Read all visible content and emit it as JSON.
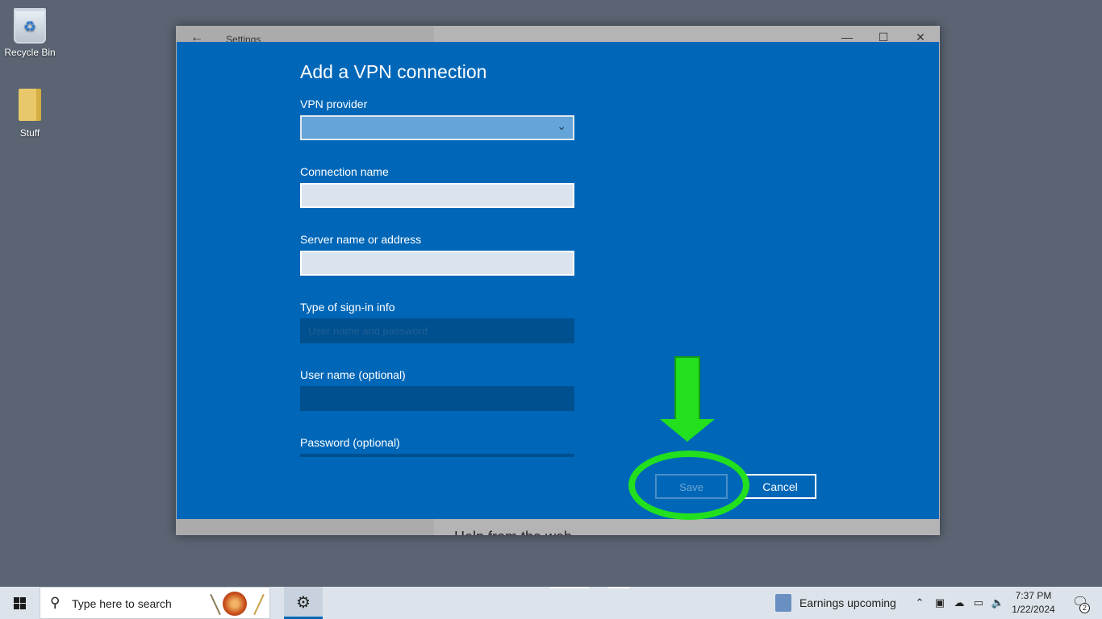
{
  "desktop": {
    "icons": [
      {
        "label": "Recycle Bin",
        "icon": "recycle-bin-icon"
      },
      {
        "label": "Stuff",
        "icon": "folder-icon"
      }
    ]
  },
  "settings_window": {
    "title": "Settings",
    "footer_text": "Help from the web",
    "controls": {
      "back": "←",
      "minimize": "—",
      "maximize": "☐",
      "close": "✕"
    }
  },
  "dialog": {
    "title": "Add a VPN connection",
    "fields": {
      "vpn_provider": {
        "label": "VPN provider",
        "value": ""
      },
      "connection_name": {
        "label": "Connection name",
        "value": ""
      },
      "server": {
        "label": "Server name or address",
        "value": ""
      },
      "sign_in_type": {
        "label": "Type of sign-in info",
        "value": "User name and password"
      },
      "username": {
        "label": "User name (optional)",
        "value": ""
      },
      "password": {
        "label": "Password (optional)",
        "value": ""
      }
    },
    "buttons": {
      "save": "Save",
      "cancel": "Cancel"
    }
  },
  "taskbar": {
    "search_placeholder": "Type here to search",
    "news_text": "Earnings upcoming",
    "time": "7:37 PM",
    "date": "1/22/2024",
    "notification_count": "2"
  },
  "colors": {
    "dialog_bg": "#0067b8",
    "annotation": "#22e01e"
  }
}
